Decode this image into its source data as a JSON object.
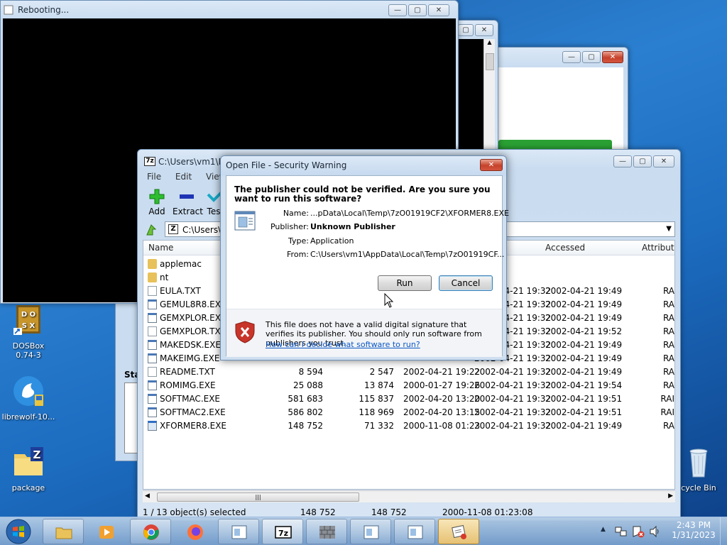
{
  "desktop": {
    "icons": [
      {
        "label": "DOSBox\n0.74-3",
        "name": "dosbox"
      },
      {
        "label": "librewolf-10...",
        "name": "librewolf"
      },
      {
        "label": "package",
        "name": "package"
      },
      {
        "label": "cycle Bin",
        "name": "recycle-bin"
      }
    ]
  },
  "reboot_window": {
    "title": "Rebooting..."
  },
  "bg_window": {
    "partial_label": "Sta"
  },
  "sevenzip": {
    "title": "C:\\Users\\vm1\\Do",
    "app_icon_text": "7z",
    "menu": [
      "File",
      "Edit",
      "View"
    ],
    "toolbar": {
      "add": "Add",
      "extract": "Extract",
      "test": "Tes"
    },
    "path": "C:\\Users\\v",
    "columns": {
      "name": "Name",
      "accessed": "Accessed",
      "attributes": "Attribute"
    },
    "rows": [
      {
        "name": "applemac",
        "type": "folder",
        "size": "",
        "packed": "",
        "modified": "",
        "created": "",
        "accessed": "",
        "attr": ""
      },
      {
        "name": "nt",
        "type": "folder",
        "size": "",
        "packed": "",
        "modified": "",
        "created": "",
        "accessed": "",
        "attr": ""
      },
      {
        "name": "EULA.TXT",
        "type": "txt",
        "size": "",
        "packed": "",
        "modified": "",
        "created": "2002-04-21 19:32",
        "accessed": "2002-04-21 19:49",
        "attr": "RA"
      },
      {
        "name": "GEMUL8R8.EXE",
        "type": "exe",
        "size": "",
        "packed": "",
        "modified": "",
        "created": "2002-04-21 19:32",
        "accessed": "2002-04-21 19:49",
        "attr": "RA"
      },
      {
        "name": "GEMXPLOR.EXE",
        "type": "exe",
        "size": "",
        "packed": "",
        "modified": "",
        "created": "2002-04-21 19:32",
        "accessed": "2002-04-21 19:49",
        "attr": "RA"
      },
      {
        "name": "GEMXPLOR.TXT",
        "type": "txt",
        "size": "",
        "packed": "",
        "modified": "",
        "created": "2002-04-21 19:32",
        "accessed": "2002-04-21 19:52",
        "attr": "RA"
      },
      {
        "name": "MAKEDSK.EXE",
        "type": "exe",
        "size": "",
        "packed": "",
        "modified": "",
        "created": "2002-04-21 19:32",
        "accessed": "2002-04-21 19:49",
        "attr": "RA"
      },
      {
        "name": "MAKEIMG.EXE",
        "type": "exe",
        "size": "",
        "packed": "",
        "modified": "",
        "created": "2002-04-21 19:32",
        "accessed": "2002-04-21 19:49",
        "attr": "RA"
      },
      {
        "name": "README.TXT",
        "type": "txt",
        "size": "8 594",
        "packed": "2 547",
        "modified": "2002-04-21 19:22",
        "created": "2002-04-21 19:32",
        "accessed": "2002-04-21 19:49",
        "attr": "RA"
      },
      {
        "name": "ROMIMG.EXE",
        "type": "exe",
        "size": "25 088",
        "packed": "13 874",
        "modified": "2000-01-27 19:26",
        "created": "2002-04-21 19:32",
        "accessed": "2002-04-21 19:54",
        "attr": "RA"
      },
      {
        "name": "SOFTMAC.EXE",
        "type": "exe",
        "size": "581 683",
        "packed": "115 837",
        "modified": "2002-04-20 13:20",
        "created": "2002-04-21 19:32",
        "accessed": "2002-04-21 19:51",
        "attr": "RAI"
      },
      {
        "name": "SOFTMAC2.EXE",
        "type": "exe",
        "size": "586 802",
        "packed": "118 969",
        "modified": "2002-04-20 13:15",
        "created": "2002-04-21 19:32",
        "accessed": "2002-04-21 19:51",
        "attr": "RAI"
      },
      {
        "name": "XFORMER8.EXE",
        "type": "exe-selected",
        "size": "148 752",
        "packed": "71 332",
        "modified": "2000-11-08 01:23",
        "created": "2002-04-21 19:32",
        "accessed": "2002-04-21 19:49",
        "attr": "RA"
      }
    ],
    "status": {
      "selected": "1 / 13 object(s) selected",
      "size": "148 752",
      "packed": "148 752",
      "date": "2000-11-08 01:23:08"
    }
  },
  "dialog": {
    "title": "Open File - Security Warning",
    "question": "The publisher could not be verified.  Are you sure you want to run this software?",
    "fields": {
      "name_label": "Name:",
      "name_value": "...pData\\Local\\Temp\\7zO01919CF2\\XFORMER8.EXE",
      "publisher_label": "Publisher:",
      "publisher_value": "Unknown Publisher",
      "type_label": "Type:",
      "type_value": "Application",
      "from_label": "From:",
      "from_value": "C:\\Users\\vm1\\AppData\\Local\\Temp\\7zO01919CF..."
    },
    "run": "Run",
    "cancel": "Cancel",
    "warning": "This file does not have a valid digital signature that verifies its publisher.  You should only run software from publishers you trust.",
    "help_link": "How can I decide what software to run?"
  },
  "taskbar": {
    "items": [
      "start",
      "explorer",
      "media-player",
      "chrome",
      "firefox",
      "window-1",
      "7zip",
      "wall-app",
      "window-2",
      "window-3",
      "security-app"
    ],
    "time": "2:43 PM",
    "date": "1/31/2023"
  },
  "colors": {
    "accent": "#3c7fb1",
    "link": "#0b57c6",
    "shield": "#c8352a"
  }
}
